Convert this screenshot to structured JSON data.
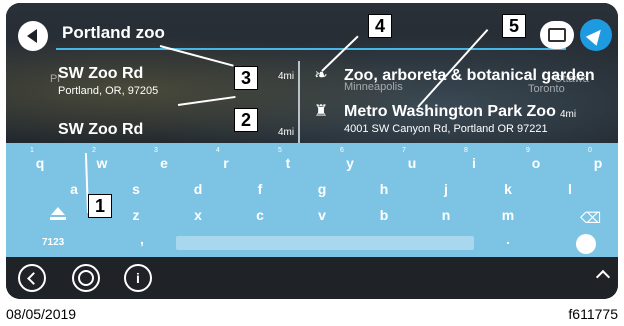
{
  "search": {
    "query": "Portland zoo"
  },
  "results_left": [
    {
      "name": "SW Zoo Rd",
      "address": "Portland, OR, 97205",
      "distance": "4mi"
    },
    {
      "name": "SW Zoo Rd",
      "address": "",
      "distance": "4mi"
    }
  ],
  "results_right": [
    {
      "name": "Zoo, arboreta & botanical garden",
      "address": "",
      "distance": "",
      "icon": "category-icon"
    },
    {
      "name": "Metro Washington Park Zoo",
      "address": "4001 SW Canyon Rd, Portland OR 97221",
      "distance": "4mi",
      "icon": "poi-zoo-icon"
    }
  ],
  "map_labels": {
    "city1": "Minneapolis",
    "city2": "Toronto",
    "city3": "Ottawa",
    "city4": "Pl"
  },
  "keyboard": {
    "row1": [
      {
        "k": "q",
        "s": "1"
      },
      {
        "k": "w",
        "s": "2"
      },
      {
        "k": "e",
        "s": "3"
      },
      {
        "k": "r",
        "s": "4"
      },
      {
        "k": "t",
        "s": "5"
      },
      {
        "k": "y",
        "s": "6"
      },
      {
        "k": "u",
        "s": "7"
      },
      {
        "k": "i",
        "s": "8"
      },
      {
        "k": "o",
        "s": "9"
      },
      {
        "k": "p",
        "s": "0"
      }
    ],
    "row2": [
      "a",
      "s",
      "d",
      "f",
      "g",
      "h",
      "j",
      "k",
      "l"
    ],
    "row3": [
      "z",
      "x",
      "c",
      "v",
      "b",
      "n",
      "m"
    ],
    "mode_key": "7123",
    "comma": ",",
    "period": "."
  },
  "bottombar": {
    "info_label": "i"
  },
  "callouts": [
    "1",
    "2",
    "3",
    "4",
    "5"
  ],
  "footer": {
    "date": "08/05/2019",
    "code": "f611775"
  },
  "colors": {
    "accent": "#1e9be0",
    "keyboard_bg": "#7cc3e4",
    "search_line": "#49b7e6"
  }
}
